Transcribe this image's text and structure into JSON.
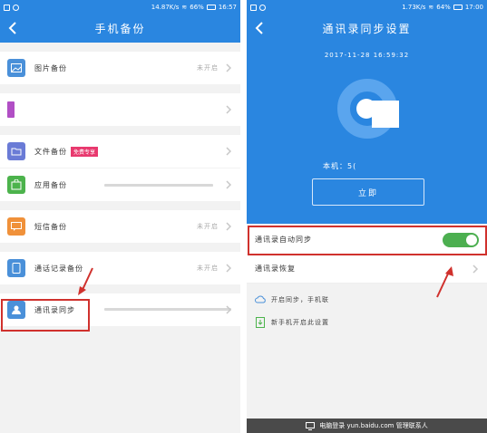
{
  "left": {
    "status": {
      "speed": "14.87K/s",
      "battery": "66%",
      "time": "16:57"
    },
    "title": "手机备份",
    "items": [
      {
        "label": "图片备份",
        "status": "未开启",
        "color": "#4a90d9"
      },
      {
        "label": "",
        "status": "",
        "color": "#b14fc5"
      },
      {
        "label": "文件备份",
        "badge": "免费专享",
        "status": "",
        "color": "#6a7bd6"
      },
      {
        "label": "应用备份",
        "status": "",
        "color": "#4cb34c"
      },
      {
        "label": "短信备份",
        "status": "未开启",
        "color": "#f0913a"
      },
      {
        "label": "通话记录备份",
        "status": "未开启",
        "color": "#4a90d9"
      },
      {
        "label": "通讯录同步",
        "status": "",
        "color": "#4a90d9"
      }
    ]
  },
  "right": {
    "status": {
      "speed": "1.73K/s",
      "battery": "64%",
      "time": "17:00"
    },
    "title": "通讯录同步设置",
    "date": "2017-11-28   16:59:32",
    "local_label": "本机：5(",
    "sync_button": "立即",
    "settings": [
      {
        "label": "通讯录自动同步",
        "toggle": true
      },
      {
        "label": "通讯录恢复",
        "toggle": false
      }
    ],
    "tips": [
      {
        "text": "开启同步，手机联"
      },
      {
        "text": "新手机开启此设置"
      }
    ],
    "footer": "电脑登录 yun.baidu.com 管理联系人"
  }
}
